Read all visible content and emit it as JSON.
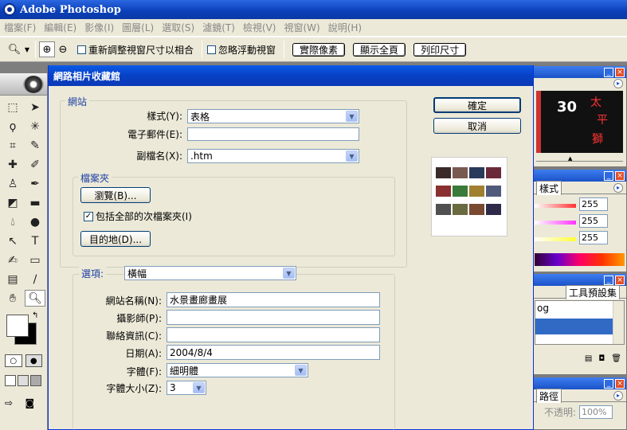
{
  "window": {
    "title": "Adobe Photoshop"
  },
  "menu": [
    "檔案(F)",
    "編輯(E)",
    "影像(I)",
    "圖層(L)",
    "選取(S)",
    "濾鏡(T)",
    "檢視(V)",
    "視窗(W)",
    "說明(H)"
  ],
  "options": {
    "resize_label": "重新調整視窗尺寸以相合",
    "ignore_label": "忽略浮動視窗",
    "actual_pixels": "實際像素",
    "fit_screen": "顯示全頁",
    "print_size": "列印尺寸"
  },
  "dialog": {
    "title": "網路相片收藏館",
    "ok": "確定",
    "cancel": "取消",
    "site": {
      "legend": "網站",
      "style_label": "樣式(Y):",
      "style_value": "表格",
      "email_label": "電子郵件(E):",
      "email_value": "",
      "ext_label": "副檔名(X):",
      "ext_value": ".htm"
    },
    "folders": {
      "legend": "檔案夾",
      "browse": "瀏覽(B)...",
      "include_sub": "包括全部的次檔案夾(I)",
      "include_checked": true,
      "destination": "目的地(D)..."
    },
    "options": {
      "legend": "選項:",
      "section": "橫幅",
      "site_name_label": "網站名稱(N):",
      "site_name_value": "水景畫廊畫展",
      "photographer_label": "攝影師(P):",
      "photographer_value": "",
      "contact_label": "聯絡資訊(C):",
      "contact_value": "",
      "date_label": "日期(A):",
      "date_value": "2004/8/4",
      "font_label": "字體(F):",
      "font_value": "細明體",
      "font_size_label": "字體大小(Z):",
      "font_size_value": "3"
    }
  },
  "panels": {
    "navigator_image_text": [
      "30",
      "太",
      "平",
      "獅"
    ],
    "color_tab": "樣式",
    "color_values": [
      "255",
      "255",
      "255"
    ],
    "brush_tab": "工具預設集",
    "brush_text": "og",
    "layers_tab": "路徑",
    "opacity_label": "不透明:",
    "opacity_value": "100%"
  },
  "colors": {
    "titlebar": "#0a3fb8",
    "dialog_title": "#0841c5",
    "legend": "#1c3fa3",
    "workspace": "#7e7e7e"
  }
}
